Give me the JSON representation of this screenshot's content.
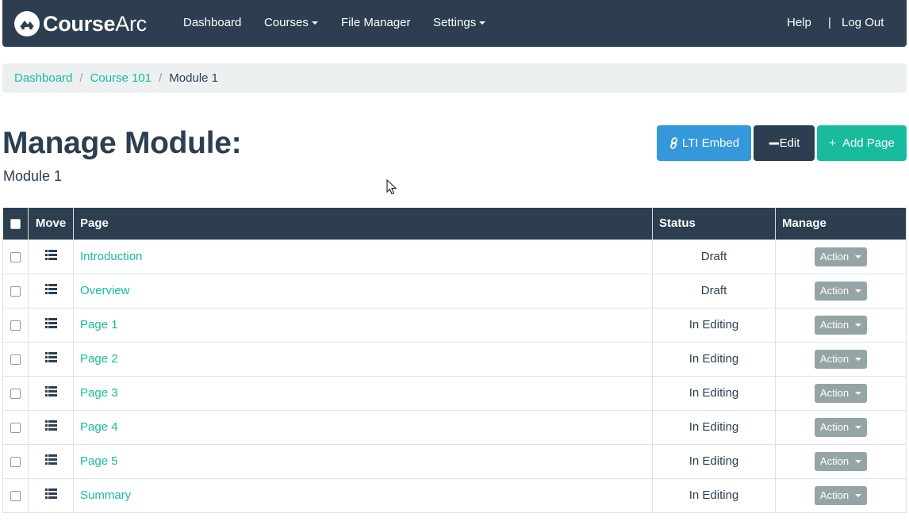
{
  "brand": {
    "name_bold": "Course",
    "name_light": "Arc"
  },
  "nav": {
    "dashboard": "Dashboard",
    "courses": "Courses",
    "file_manager": "File Manager",
    "settings": "Settings",
    "help": "Help",
    "separator": "|",
    "logout": "Log Out"
  },
  "breadcrumb": {
    "items": [
      "Dashboard",
      "Course 101"
    ],
    "separator": "/",
    "active": "Module 1"
  },
  "header": {
    "title": "Manage Module:",
    "subtitle": "Module 1"
  },
  "toolbar": {
    "lti_embed": "LTI Embed",
    "edit": "Edit",
    "add_page": "Add Page",
    "add_prefix": "+"
  },
  "table": {
    "columns": {
      "move": "Move",
      "page": "Page",
      "status": "Status",
      "manage": "Manage"
    },
    "action_label": "Action",
    "rows": [
      {
        "page": "Introduction",
        "status": "Draft"
      },
      {
        "page": "Overview",
        "status": "Draft"
      },
      {
        "page": "Page 1",
        "status": "In Editing"
      },
      {
        "page": "Page 2",
        "status": "In Editing"
      },
      {
        "page": "Page 3",
        "status": "In Editing"
      },
      {
        "page": "Page 4",
        "status": "In Editing"
      },
      {
        "page": "Page 5",
        "status": "In Editing"
      },
      {
        "page": "Summary",
        "status": "In Editing"
      }
    ]
  },
  "colors": {
    "navbar": "#2c3e50",
    "accent_green": "#18bc9c",
    "accent_blue": "#3498db",
    "action_gray": "#95a5a6",
    "breadcrumb_bg": "#ecf0f1"
  }
}
